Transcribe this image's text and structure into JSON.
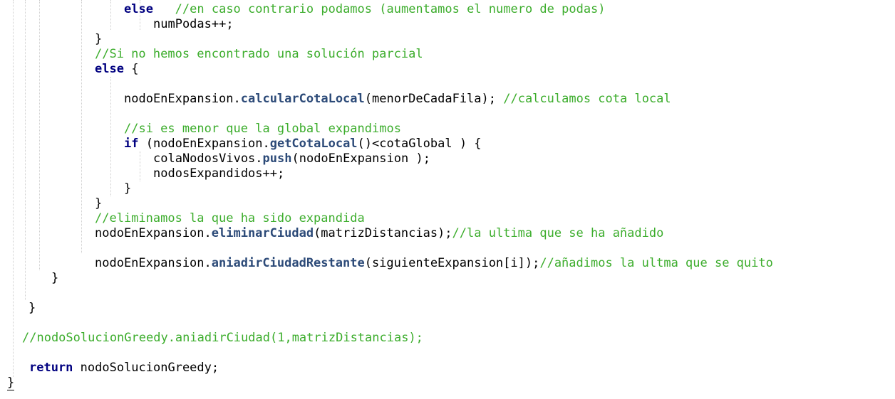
{
  "code": {
    "l1": {
      "kw": "else",
      "comment": "//en caso contrario podamos (aumentamos el numero de podas)"
    },
    "l2": {
      "text": "numPodas++;"
    },
    "l3": {
      "text": "}"
    },
    "l4": {
      "comment": "//Si no hemos encontrado una solución parcial"
    },
    "l5": {
      "kw": "else",
      "text": " {"
    },
    "l6": {
      "pre": "nodoEnExpansion.",
      "fn": "calcularCotaLocal",
      "post": "(menorDeCadaFila); ",
      "comment": "//calculamos cota local"
    },
    "l7": {
      "comment": "//si es menor que la global expandimos"
    },
    "l8": {
      "kw": "if",
      "pre": " (nodoEnExpansion.",
      "fn": "getCotaLocal",
      "post": "()<cotaGlobal ) {"
    },
    "l9": {
      "pre": "colaNodosVivos.",
      "fn": "push",
      "post": "(nodoEnExpansion );"
    },
    "l10": {
      "text": "nodosExpandidos++;"
    },
    "l11": {
      "text": "}"
    },
    "l12": {
      "text": "}"
    },
    "l13": {
      "comment": "//eliminamos la que ha sido expandida"
    },
    "l14": {
      "pre": "nodoEnExpansion.",
      "fn": "eliminarCiudad",
      "post": "(matrizDistancias);",
      "comment": "//la ultima que se ha añadido"
    },
    "l15": {
      "pre": "nodoEnExpansion.",
      "fn": "aniadirCiudadRestante",
      "post": "(siguienteExpansion[i]);",
      "comment": "//añadimos la ultma que se quito"
    },
    "l16": {
      "text": "}"
    },
    "l17": {
      "text": "}"
    },
    "l18": {
      "comment": "//nodoSolucionGreedy.aniadirCiudad(1,matrizDistancias);"
    },
    "l19": {
      "kw": "return",
      "text": " nodoSolucionGreedy;"
    },
    "l20": {
      "text": "}"
    }
  },
  "colors": {
    "keyword": "#000080",
    "comment": "#3cad2c",
    "method": "#2c4a78",
    "background": "#ffffff"
  }
}
